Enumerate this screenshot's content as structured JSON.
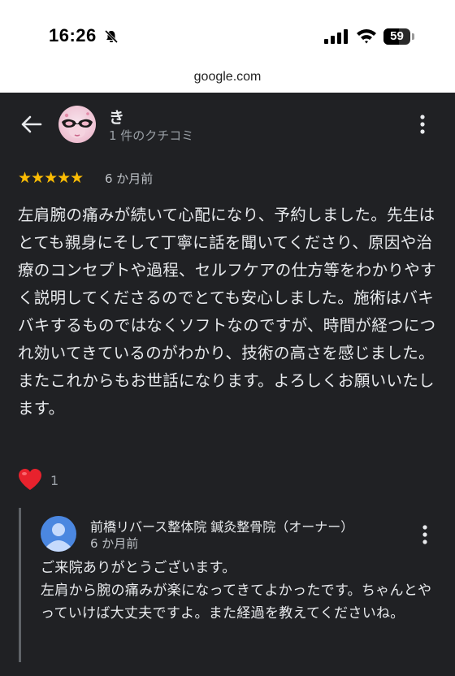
{
  "status_bar": {
    "time": "16:26",
    "battery": "59"
  },
  "browser": {
    "url": "google.com"
  },
  "review": {
    "reviewer_name": "き",
    "reviewer_review_count": "1 件のクチコミ",
    "rating": "★★★★★",
    "date": "6 か月前",
    "text": "左肩腕の痛みが続いて心配になり、予約しました。先生はとても親身にそして丁寧に話を聞いてくださり、原因や治療のコンセプトや過程、セルフケアの仕方等をわかりやすく説明してくださるのでとても安心しました。施術はバキバキするものではなくソフトなのですが、時間が経つにつれ効いてきているのがわかり、技術の高さを感じました。またこれからもお世話になります。よろしくお願いいたします。",
    "reaction_count": "1"
  },
  "owner_reply": {
    "name": "前橋リバース整体院 鍼灸整骨院（オーナー）",
    "date": "6 か月前",
    "text_line1": "ご来院ありがとうございます。",
    "text_body": "左肩から腕の痛みが楽になってきてよかったです。ちゃんとやっていけば大丈夫ですよ。また経過を教えてくださいね。"
  },
  "colors": {
    "background": "#202124",
    "star": "#fbbc04",
    "heart": "#e8222d",
    "owner_avatar": "#4b87e0"
  },
  "icons": [
    "bell-slash-icon",
    "signal-icon",
    "wifi-icon",
    "battery-icon",
    "back-arrow-icon",
    "more-vert-icon",
    "heart-icon",
    "person-icon"
  ]
}
